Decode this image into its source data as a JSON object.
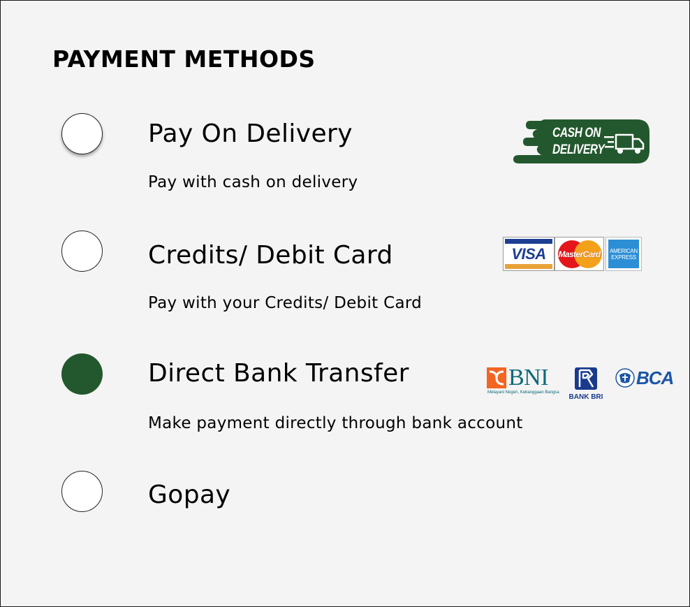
{
  "colors": {
    "background": "#f4f4f4",
    "selected_radio": "#23582e",
    "cod_badge": "#23582e",
    "text": "#000000"
  },
  "header": {
    "title": "PAYMENT METHODS"
  },
  "options": [
    {
      "id": "pay-on-delivery",
      "title": "Pay On Delivery",
      "description": "Pay with cash on delivery",
      "selected": false,
      "logo": {
        "icon": "cash-on-delivery-truck-icon",
        "line1": "CASH ON",
        "line2": "DELIVERY"
      }
    },
    {
      "id": "credit-debit-card",
      "title": "Credits/ Debit Card",
      "description": "Pay with your Credits/ Debit Card",
      "selected": false,
      "logos": {
        "visa": "VISA",
        "mastercard": "MasterCard",
        "amex_line1": "AMERICAN",
        "amex_line2": "EXPRESS"
      }
    },
    {
      "id": "direct-bank-transfer",
      "title": "Direct Bank Transfer",
      "description": "Make payment directly through bank account",
      "selected": true,
      "logos": {
        "bni": "BNI",
        "bni_tagline": "Melayani Negeri, Kebanggaan Bangsa",
        "bri": "BANK BRI",
        "bca": "BCA"
      }
    },
    {
      "id": "gopay",
      "title": "Gopay",
      "description": "",
      "selected": false
    }
  ]
}
